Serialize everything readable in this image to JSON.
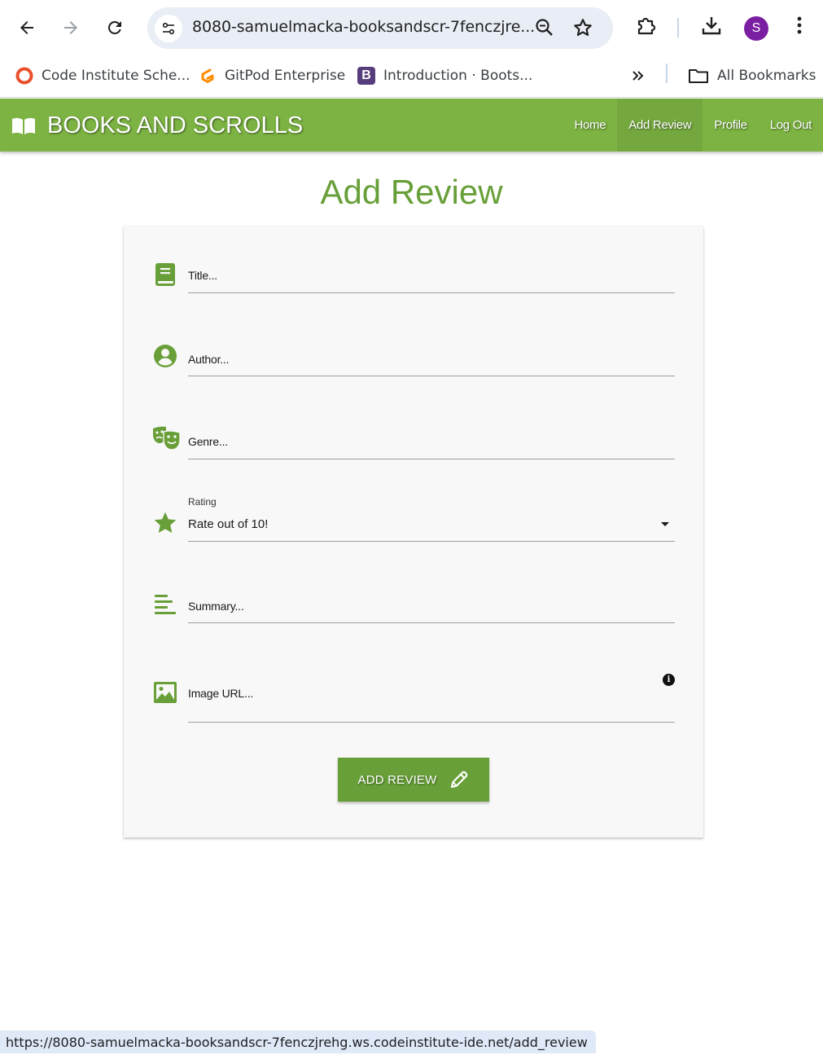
{
  "browser": {
    "url": "8080-samuelmacka-booksandscr-7fenczjre...",
    "avatar_letter": "S",
    "bookmarks": [
      {
        "label": "Code Institute Sche...",
        "icon": "code-institute-icon"
      },
      {
        "label": "GitPod Enterprise",
        "icon": "gitpod-icon"
      },
      {
        "label": "Introduction · Boots...",
        "icon": "bootstrap-icon"
      }
    ],
    "all_bookmarks_label": "All Bookmarks",
    "status_url": "https://8080-samuelmacka-booksandscr-7fenczjrehg.ws.codeinstitute-ide.net/add_review"
  },
  "site": {
    "brand": "BOOKS AND SCROLLS",
    "nav": [
      "Home",
      "Add Review",
      "Profile",
      "Log Out"
    ],
    "accent_color": "#7cb342",
    "dark_accent_color": "#689f38"
  },
  "form": {
    "page_title": "Add Review",
    "title_placeholder": "Title...",
    "author_placeholder": "Author...",
    "genre_placeholder": "Genre...",
    "rating_label": "Rating",
    "rating_value": "Rate out of 10!",
    "summary_placeholder": "Summary...",
    "image_url_placeholder": "Image URL...",
    "info_glyph": "i",
    "submit_label": "ADD REVIEW"
  }
}
